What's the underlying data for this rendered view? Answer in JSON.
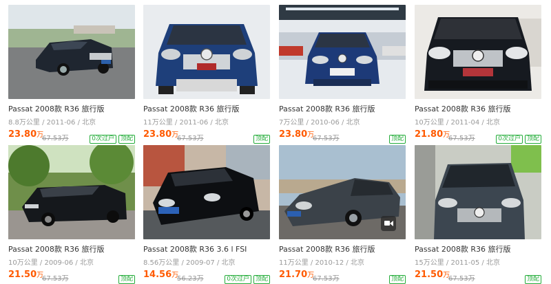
{
  "listings": [
    {
      "title": "Passat 2008款 R36 旅行版",
      "subtitle": "8.8万公里 / 2011-06 / 北京",
      "price": "23.80",
      "price_unit": "万",
      "original_price": "67.53万",
      "tags": [
        "0次过户",
        "顶配"
      ],
      "photo_label": "black wagon front-left in parking lot"
    },
    {
      "title": "Passat 2008款 R36 旅行版",
      "subtitle": "11万公里 / 2011-06 / 北京",
      "price": "23.80",
      "price_unit": "万",
      "original_price": "67.53万",
      "tags": [
        "顶配"
      ],
      "photo_label": "blue car front view"
    },
    {
      "title": "Passat 2008款 R36 旅行版",
      "subtitle": "7万公里 / 2010-06 / 北京",
      "price": "23.80",
      "price_unit": "万",
      "original_price": "67.53万",
      "tags": [
        "顶配"
      ],
      "photo_label": "blue car front in showroom"
    },
    {
      "title": "Passat 2008款 R36 旅行版",
      "subtitle": "10万公里 / 2011-04 / 北京",
      "price": "21.80",
      "price_unit": "万",
      "original_price": "67.53万",
      "tags": [
        "0次过户",
        "顶配"
      ],
      "photo_label": "black car front view indoor"
    },
    {
      "title": "Passat 2008款 R36 旅行版",
      "subtitle": "10万公里 / 2009-06 / 北京",
      "price": "21.50",
      "price_unit": "万",
      "original_price": "67.53万",
      "tags": [
        "顶配"
      ],
      "photo_label": "black wagon under trees"
    },
    {
      "title": "Passat 2008款 R36 3.6 l FSI",
      "subtitle": "8.56万公里 / 2009-07 / 北京",
      "price": "14.56",
      "price_unit": "万",
      "original_price": "56.23万",
      "tags": [
        "0次过户",
        "顶配"
      ],
      "photo_label": "black car on street"
    },
    {
      "title": "Passat 2008款 R36 旅行版",
      "subtitle": "11万公里 / 2010-12 / 北京",
      "price": "21.70",
      "price_unit": "万",
      "original_price": "67.53万",
      "tags": [
        "顶配"
      ],
      "photo_label": "grey wagon side view, video"
    },
    {
      "title": "Passat 2008款 R36 旅行版",
      "subtitle": "15万公里 / 2011-05 / 北京",
      "price": "21.50",
      "price_unit": "万",
      "original_price": "67.53万",
      "tags": [
        "顶配"
      ],
      "photo_label": "dark grey car in garage"
    }
  ],
  "icons": {
    "video": "video-play-icon"
  },
  "colors": {
    "price": "#ff5a00",
    "tag": "#22ac38",
    "title": "#333333",
    "meta": "#999999"
  }
}
